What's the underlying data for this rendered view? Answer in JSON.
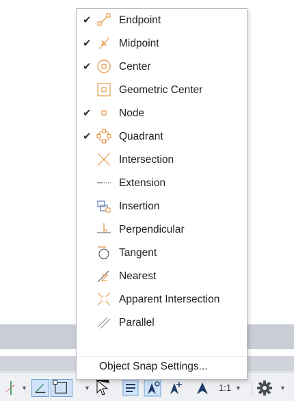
{
  "menu": {
    "items": [
      {
        "label": "Endpoint",
        "checked": true,
        "icon": "endpoint-snap-icon"
      },
      {
        "label": "Midpoint",
        "checked": true,
        "icon": "midpoint-snap-icon"
      },
      {
        "label": "Center",
        "checked": true,
        "icon": "center-snap-icon"
      },
      {
        "label": "Geometric Center",
        "checked": false,
        "icon": "geometric-center-snap-icon"
      },
      {
        "label": "Node",
        "checked": true,
        "icon": "node-snap-icon"
      },
      {
        "label": "Quadrant",
        "checked": true,
        "icon": "quadrant-snap-icon"
      },
      {
        "label": "Intersection",
        "checked": false,
        "icon": "intersection-snap-icon"
      },
      {
        "label": "Extension",
        "checked": false,
        "icon": "extension-snap-icon"
      },
      {
        "label": "Insertion",
        "checked": false,
        "icon": "insertion-snap-icon"
      },
      {
        "label": "Perpendicular",
        "checked": false,
        "icon": "perpendicular-snap-icon"
      },
      {
        "label": "Tangent",
        "checked": false,
        "icon": "tangent-snap-icon"
      },
      {
        "label": "Nearest",
        "checked": false,
        "icon": "nearest-snap-icon"
      },
      {
        "label": "Apparent Intersection",
        "checked": false,
        "icon": "apparent-intersection-snap-icon"
      },
      {
        "label": "Parallel",
        "checked": false,
        "icon": "parallel-snap-icon"
      }
    ],
    "check_glyph": "✔",
    "settings_label": "Object Snap Settings..."
  },
  "statusbar": {
    "caret": "▼",
    "scale_label": "1:1",
    "object_snap_pressed": true,
    "isometric_pressed": true,
    "accent_color": "#cfe2f7",
    "snap_icon_color": "#e0903a"
  }
}
